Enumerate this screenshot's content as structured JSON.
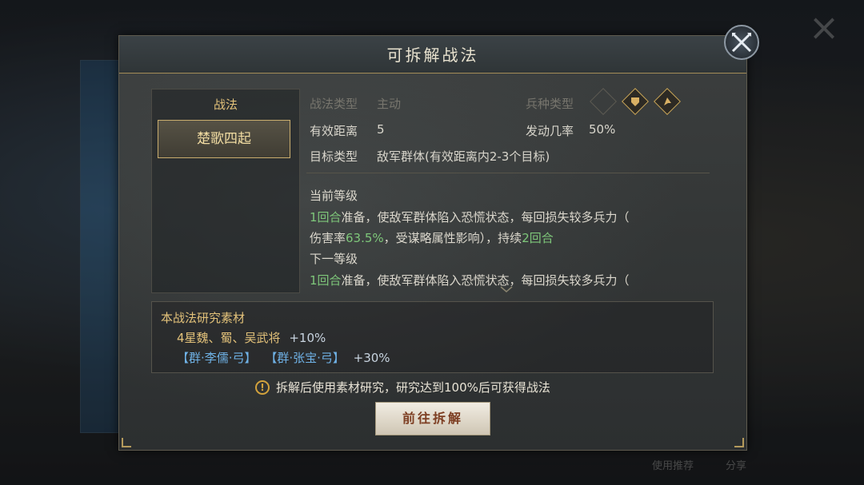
{
  "dialog": {
    "title": "可拆解战法",
    "left_panel_title": "战法",
    "tactics": [
      "楚歌四起"
    ]
  },
  "info": {
    "tactic_type_label": "战法类型",
    "tactic_type_value": "主动",
    "troop_type_label": "兵种类型",
    "troop_type_icons": [
      "cavalry-icon",
      "shield-icon",
      "archer-icon"
    ],
    "range_label": "有效距离",
    "range_value": "5",
    "trigger_label": "发动几率",
    "trigger_value": "50%",
    "target_label": "目标类型",
    "target_value": "敌军群体(有效距离内2-3个目标)"
  },
  "desc": {
    "current_heading": "当前等级",
    "current_1_prep": "1回合",
    "current_1_text": "准备，使敌军群体陷入恐慌状态，每回损失较多兵力（",
    "current_2_a": "伤害率",
    "current_2_rate": "63.5%",
    "current_2_b": "，受谋略属性影响），持续",
    "current_2_dur": "2回合",
    "next_heading": "下一等级",
    "next_1_prep": "1回合",
    "next_1_text": "准备，使敌军群体陷入恐慌状态，每回损失较多兵力（"
  },
  "materials": {
    "title": "本战法研究素材",
    "line1_text": "4星魏、蜀、吴武将",
    "line1_bonus": "+10%",
    "line2_item1": "【群·李儒·弓】",
    "line2_item2": "【群·张宝·弓】",
    "line2_bonus": "+30%"
  },
  "notice": "拆解后使用素材研究，研究达到100%后可获得战法",
  "go_button": "前往拆解",
  "background": {
    "bottom_left": "使用推荐",
    "bottom_right": "分享"
  },
  "colors": {
    "gold": "#e3c27a",
    "green": "#7ec77a",
    "blue": "#6fb2e6",
    "bonus": "#c8d4e0"
  }
}
